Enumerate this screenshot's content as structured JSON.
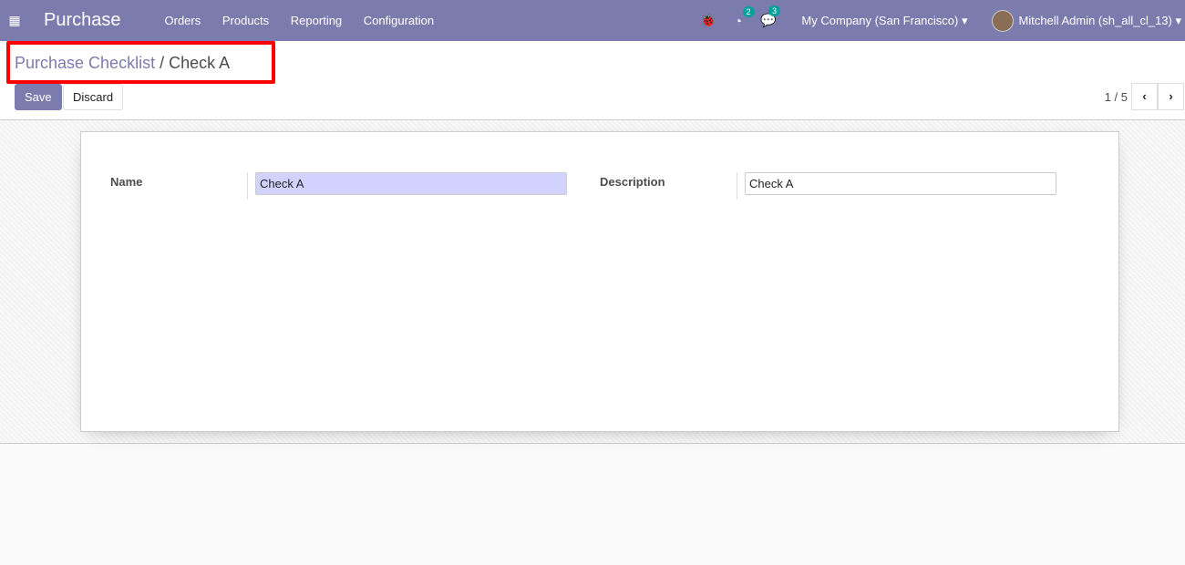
{
  "nav": {
    "app": "Purchase",
    "menu": [
      "Orders",
      "Products",
      "Reporting",
      "Configuration"
    ],
    "activity_count": "2",
    "message_count": "3",
    "company": "My Company (San Francisco)",
    "user": "Mitchell Admin (sh_all_cl_13)"
  },
  "breadcrumb": {
    "parent": "Purchase Checklist",
    "sep": "/",
    "current": "Check A"
  },
  "buttons": {
    "save": "Save",
    "discard": "Discard"
  },
  "pager": {
    "value": "1 / 5",
    "prev": "‹",
    "next": "›"
  },
  "form": {
    "name_label": "Name",
    "name_value": "Check A",
    "description_label": "Description",
    "description_value": "Check A"
  },
  "colors": {
    "brand": "#7c7bad",
    "badge": "#00a09d",
    "required_field": "#d2d2ff"
  }
}
